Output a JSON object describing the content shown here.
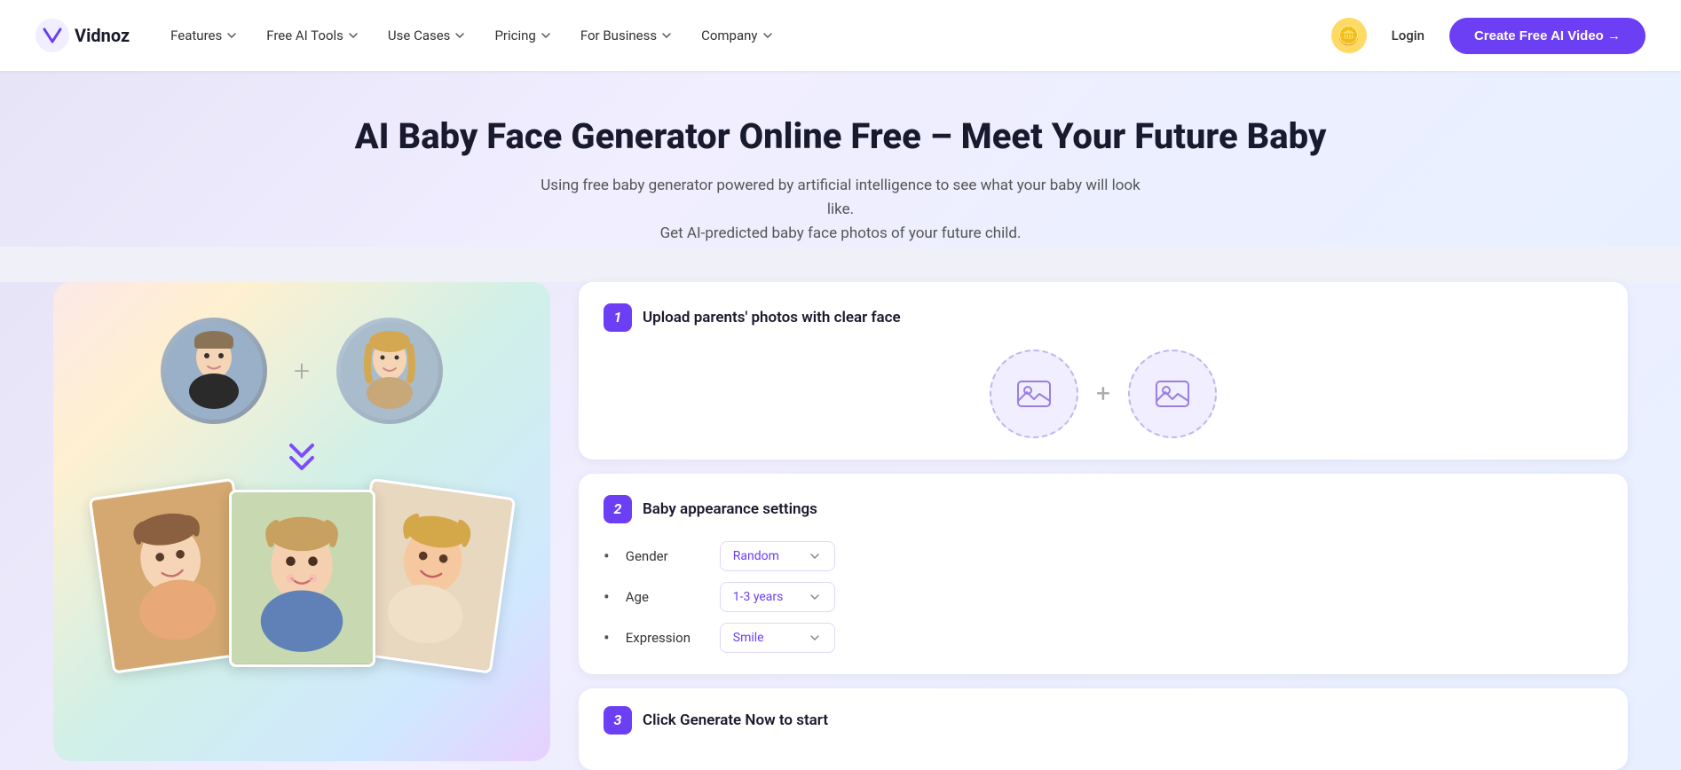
{
  "brand": {
    "name": "Vidnoz",
    "logo_letter": "V"
  },
  "nav": {
    "items": [
      {
        "label": "Features",
        "has_dropdown": true
      },
      {
        "label": "Free AI Tools",
        "has_dropdown": true
      },
      {
        "label": "Use Cases",
        "has_dropdown": true
      },
      {
        "label": "Pricing",
        "has_dropdown": true
      },
      {
        "label": "For Business",
        "has_dropdown": true
      },
      {
        "label": "Company",
        "has_dropdown": true
      }
    ],
    "login_label": "Login",
    "create_btn_label": "Create Free AI Video →"
  },
  "hero": {
    "title": "AI Baby Face Generator Online Free – Meet Your Future Baby",
    "subtitle_line1": "Using free baby generator powered by artificial intelligence to see what your baby will look like.",
    "subtitle_line2": "Get AI-predicted baby face photos of your future child."
  },
  "steps": {
    "step1": {
      "number": "1",
      "title": "Upload parents' photos with clear face"
    },
    "step2": {
      "number": "2",
      "title": "Baby appearance settings",
      "settings": [
        {
          "label": "Gender",
          "value": "Random"
        },
        {
          "label": "Age",
          "value": "1-3 years"
        },
        {
          "label": "Expression",
          "value": "Smile"
        }
      ]
    },
    "step3": {
      "number": "3",
      "title": "Click Generate Now to start"
    }
  }
}
